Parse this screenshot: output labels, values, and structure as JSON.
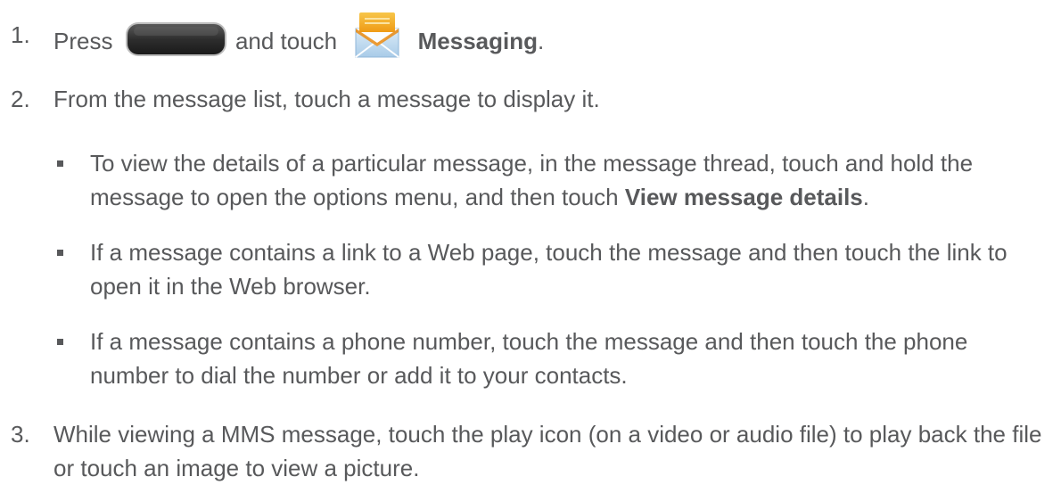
{
  "steps": [
    {
      "number": "1.",
      "pre": "Press",
      "home_key_icon": "home-key-icon",
      "mid": "and touch",
      "messaging_icon": "messaging-icon",
      "bold": "Messaging",
      "post": "."
    },
    {
      "number": "2.",
      "text": "From the message list, touch a message to display it.",
      "bullets": [
        {
          "pre": "To view the details of a particular message, in the message thread, touch and hold the message to open the options menu, and then touch ",
          "bold": "View message details",
          "post": "."
        },
        {
          "text": "If a message contains a link to a Web page, touch the message and then touch the link to open it in the Web browser."
        },
        {
          "text": "If a message contains a phone number, touch the message and then touch the phone number to dial the number or add it to your contacts."
        }
      ]
    },
    {
      "number": "3.",
      "text": "While viewing a MMS message, touch the play icon (on a video or audio file) to play back the file or touch an image to view a picture."
    }
  ],
  "colors": {
    "text": "#58595b",
    "home_key": "#3a3a3a",
    "envelope_yellow": "#f2a81d",
    "envelope_blue": "#9ec4e6"
  }
}
